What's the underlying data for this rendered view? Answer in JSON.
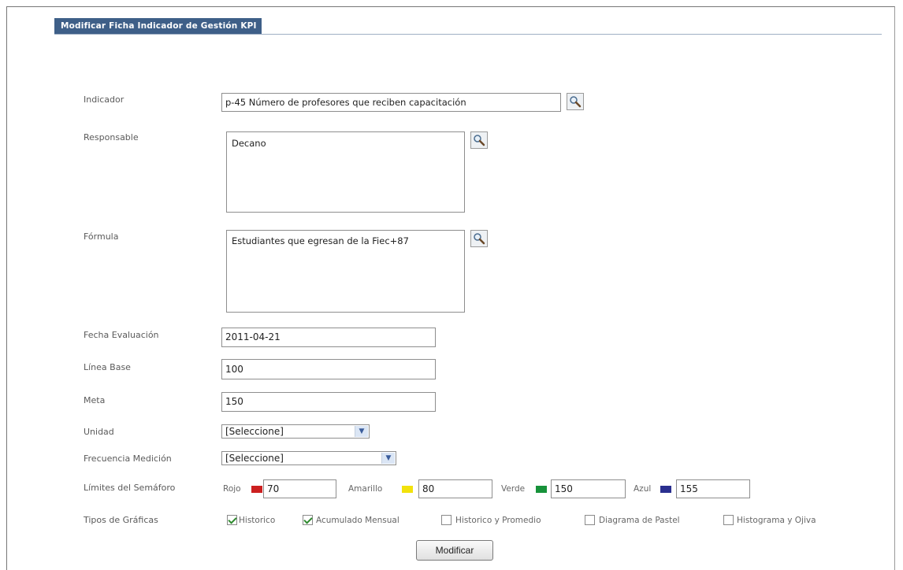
{
  "header": {
    "title": "Modificar Ficha Indicador de Gestión KPI"
  },
  "form": {
    "indicador": {
      "label": "Indicador",
      "value": "p-45 Número de profesores que reciben capacitación"
    },
    "responsable": {
      "label": "Responsable",
      "value": "Decano"
    },
    "formula": {
      "label": "Fórmula",
      "value": "Estudiantes que egresan de la Fiec+87"
    },
    "fecha": {
      "label": "Fecha Evaluación",
      "value": "2011-04-21"
    },
    "linea_base": {
      "label": "Línea Base",
      "value": "100"
    },
    "meta": {
      "label": "Meta",
      "value": "150"
    },
    "unidad": {
      "label": "Unidad",
      "value": "[Seleccione]"
    },
    "frecuencia": {
      "label": "Frecuencia Medición",
      "value": "[Seleccione]"
    },
    "semaforo": {
      "label": "Límites del Semáforo",
      "rojo": {
        "label": "Rojo",
        "value": "70",
        "color": "#cc2020"
      },
      "amarillo": {
        "label": "Amarillo",
        "value": "80",
        "color": "#f2e20c"
      },
      "verde": {
        "label": "Verde",
        "value": "150",
        "color": "#17923a"
      },
      "azul": {
        "label": "Azul",
        "value": "155",
        "color": "#2a2f8f"
      }
    },
    "tipos": {
      "label": "Tipos de Gráficas",
      "options": [
        {
          "label": "Historico",
          "checked": true
        },
        {
          "label": "Acumulado Mensual",
          "checked": true
        },
        {
          "label": "Historico y Promedio",
          "checked": false
        },
        {
          "label": "Diagrama de Pastel",
          "checked": false
        },
        {
          "label": "Histograma y Ojiva",
          "checked": false
        }
      ]
    },
    "submit_label": "Modificar"
  },
  "icons": {
    "lookup": "magnifier-icon",
    "dropdown": "chevron-down-icon"
  }
}
